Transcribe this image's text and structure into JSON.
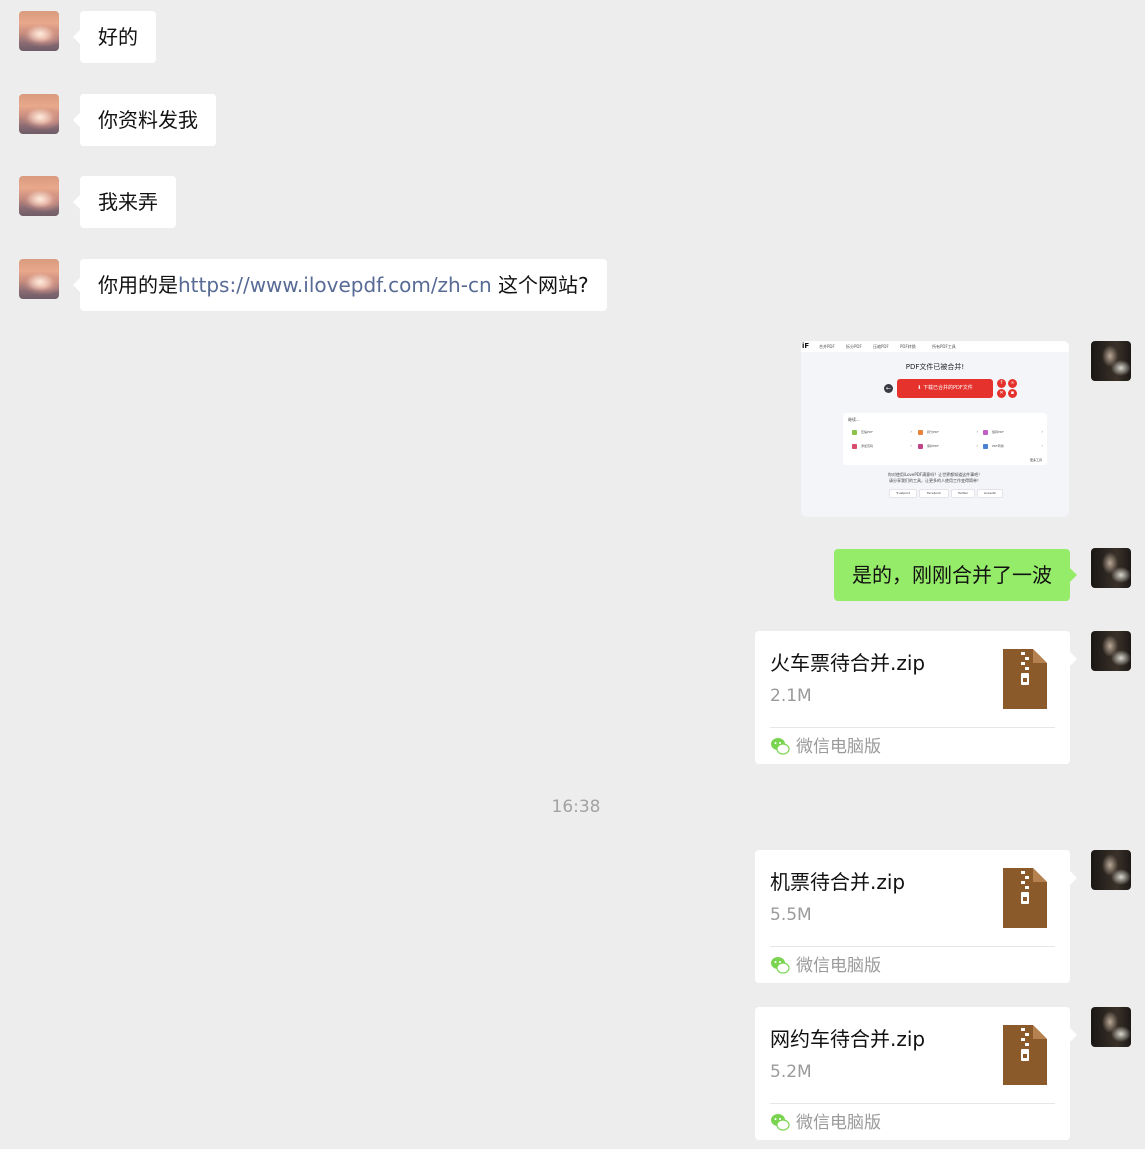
{
  "messages": [
    {
      "side": "left",
      "text": "好的"
    },
    {
      "side": "left",
      "text": "你资料发我"
    },
    {
      "side": "left",
      "text": "我来弄"
    },
    {
      "side": "left",
      "text_pre": "你用的是",
      "link": "https://www.ilovepdf.com/zh-cn",
      "text_post": " 这个网站?"
    },
    {
      "side": "right",
      "type": "image"
    },
    {
      "side": "right",
      "text": "是的，刚刚合并了一波"
    }
  ],
  "screenshot": {
    "logo": "iF",
    "nav": [
      "合并PDF",
      "拆分PDF",
      "压缩PDF",
      "PDF转换",
      "所有PDF工具"
    ],
    "title": "PDF文件已被合并!",
    "download_label": "下载已合并的PDF文件",
    "continue_label": "继续...",
    "tools": [
      "压缩PDF",
      "拆分PDF",
      "旋转PDF",
      "添加页码",
      "保护PDF",
      "PDF转换"
    ],
    "more": "更多工具",
    "footer1": "你对使用iLovePDF满意吗？让世界都知道这件事吧！",
    "footer2": "请分享我们的工具，让更多的人使用工作变得简单！",
    "share": [
      "Trustpilot",
      "Facebook",
      "Twitter",
      "LinkedIn"
    ]
  },
  "files_before_time": [
    {
      "name": "火车票待合并.zip",
      "size": "2.1M",
      "source": "微信电脑版"
    }
  ],
  "time": "16:38",
  "files_after_time": [
    {
      "name": "机票待合并.zip",
      "size": "5.5M",
      "source": "微信电脑版"
    },
    {
      "name": "网约车待合并.zip",
      "size": "5.2M",
      "source": "微信电脑版"
    }
  ],
  "colors": {
    "background": "#ededed",
    "bubble_left": "#ffffff",
    "bubble_right": "#95ec69",
    "link": "#576b95",
    "zip_icon": "#8b5a2b",
    "wechat_green": "#07c160"
  }
}
